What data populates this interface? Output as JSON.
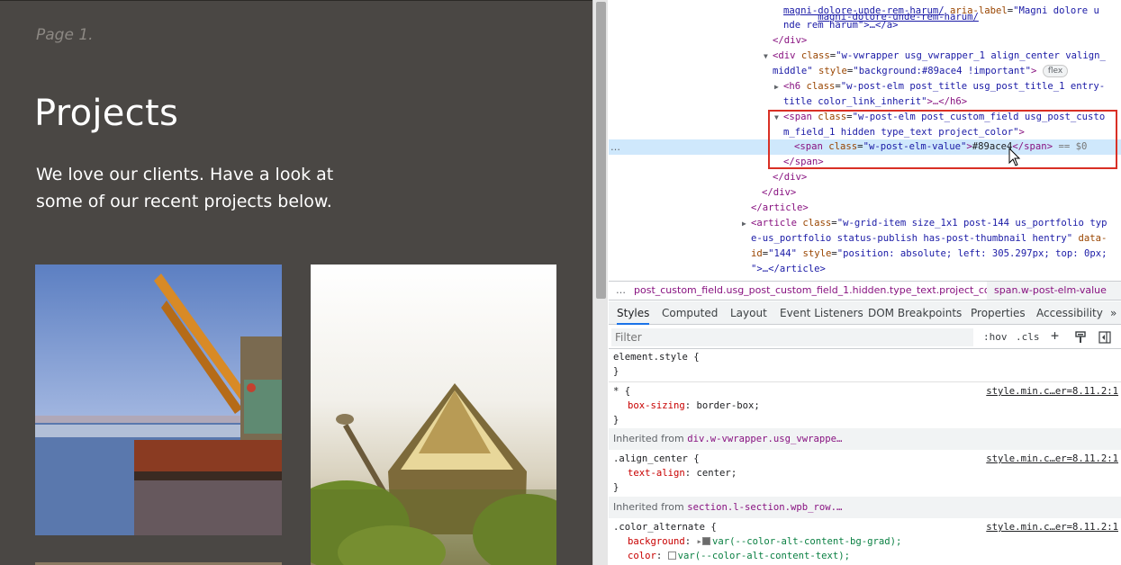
{
  "site": {
    "page_label": "Page 1.",
    "title": "Projects",
    "intro": "We love our clients. Have a look at some of our recent projects below."
  },
  "dom": {
    "line1_link": "magni-dolore-unde-rem-harum/",
    "line1_attr": "aria-label",
    "line1_val": "\"Magni dolore u",
    "line2": "nde rem harum\">…</a>",
    "close_div1": "</div>",
    "div_open_a": "<div ",
    "div_class_attr": "class",
    "div_class_val": "\"w-vwrapper usg_vwrapper_1 align_center valign_",
    "div_line2a": "middle\" ",
    "div_style_attr": "style",
    "div_style_val": "\"background:#89ace4 !important\"",
    "div_end": ">",
    "flex_badge": "flex",
    "h6_open": "<h6 ",
    "h6_class_attr": "class",
    "h6_class_val": "\"w-post-elm post_title usg_post_title_1 entry-",
    "h6_line2": "title color_link_inherit\"",
    "h6_end": ">…</h6>",
    "span_open": "<span ",
    "span_class_attr": "class",
    "span_class_val": "\"w-post-elm post_custom_field usg_post_custo",
    "span_line2": "m_field_1 hidden type_text project_color\"",
    "span_end": ">",
    "inner_span_open": "<span ",
    "inner_class_attr": "class",
    "inner_class_val": "\"w-post-elm-value\"",
    "inner_text": "#89ace4",
    "inner_close": "</span>",
    "dollar": " == $0",
    "close_span": "</span>",
    "close_div2": "</div>",
    "close_div3": "</div>",
    "close_article": "</article>",
    "article_open": "<article ",
    "article_class_attr": "class",
    "article_class_val": "\"w-grid-item size_1x1 post-144 us_portfolio typ",
    "article_line2": "e-us_portfolio status-publish has-post-thumbnail hentry\" ",
    "article_data_attr": "data-",
    "article_line3a": "id",
    "article_line3b": "\"144\" ",
    "article_style_attr": "style",
    "article_style_val": "\"position: absolute; left: 305.297px; top: 0px;",
    "article_line4": "\">…</article>",
    "dots": "…"
  },
  "breadcrumb": {
    "ellipsis": "…",
    "crumb1": "post_custom_field.usg_post_custom_field_1.hidden.type_text.project_color",
    "crumb2": "span.w-post-elm-value"
  },
  "tabs": [
    "Styles",
    "Computed",
    "Layout",
    "Event Listeners",
    "DOM Breakpoints",
    "Properties",
    "Accessibility",
    "»"
  ],
  "filter": {
    "placeholder": "Filter",
    "hov": ":hov",
    "cls": ".cls",
    "plus": "+"
  },
  "styles": {
    "element_style": "element.style {",
    "close": "}",
    "star_sel": "* {",
    "star_src": "style.min.c…er=8.11.2:1",
    "box_sizing_prop": "box-sizing",
    "box_sizing_val": "border-box;",
    "inherited_label1": "Inherited from ",
    "inherited_sel1": "div.w-vwrapper.usg_vwrappe…",
    "align_sel": ".align_center {",
    "align_src": "style.min.c…er=8.11.2:1",
    "text_align_prop": "text-align",
    "text_align_val": "center;",
    "inherited_label2": "Inherited from ",
    "inherited_sel2": "section.l-section.wpb_row.…",
    "color_alt_sel": ".color_alternate {",
    "color_alt_src": "style.min.c…er=8.11.2:1",
    "bg_prop": "background",
    "bg_var": "var(--color-alt-content-bg-grad);",
    "color_prop": "color",
    "color_var": "var(--color-alt-content-text);"
  },
  "colors": {
    "site_bg": "#4a4744",
    "highlight": "#cfe8fc",
    "red_box": "#d93025",
    "tab_active": "#1a73e8"
  }
}
